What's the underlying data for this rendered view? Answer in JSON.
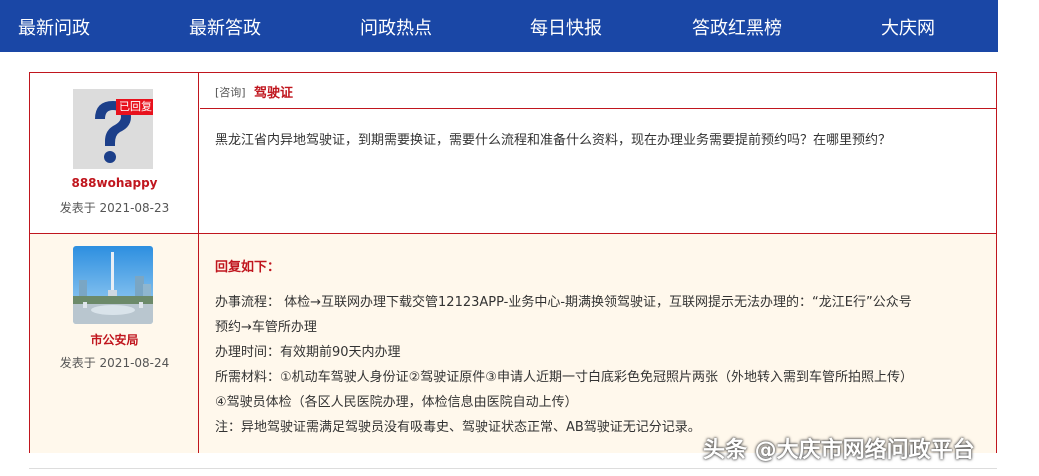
{
  "nav": {
    "items": [
      "最新问政",
      "最新答政",
      "问政热点",
      "每日快报",
      "答政红黑榜",
      "大庆网"
    ]
  },
  "question": {
    "badge": "已回复",
    "user": "888wohappy",
    "date": "发表于 2021-08-23",
    "tag": "[咨询]",
    "title": "驾驶证",
    "body": "黑龙江省内异地驾驶证，到期需要换证，需要什么流程和准备什么资料，现在办理业务需要提前预约吗？在哪里预约？"
  },
  "reply": {
    "user": "市公安局",
    "date": "发表于 2021-08-24",
    "heading": "回复如下：",
    "lines": [
      "办事流程： 体检→互联网办理下载交管12123APP-业务中心-期满换领驾驶证，互联网提示无法办理的：“龙江E行”公众号",
      "预约→车管所办理",
      "办理时间：有效期前90天内办理",
      "所需材料：①机动车驾驶人身份证②驾驶证原件③申请人近期一寸白底彩色免冠照片两张（外地转入需到车管所拍照上传）",
      "④驾驶员体检（各区人民医院办理，体检信息由医院自动上传）",
      "注：异地驾驶证需满足驾驶员没有吸毒史、驾驶证状态正常、AB驾驶证无记分记录。"
    ]
  },
  "watermark": "头条 @大庆市网络问政平台",
  "colors": {
    "nav": "#1a47a6",
    "accent": "#c0161e",
    "reply_bg": "#fff8ec"
  }
}
